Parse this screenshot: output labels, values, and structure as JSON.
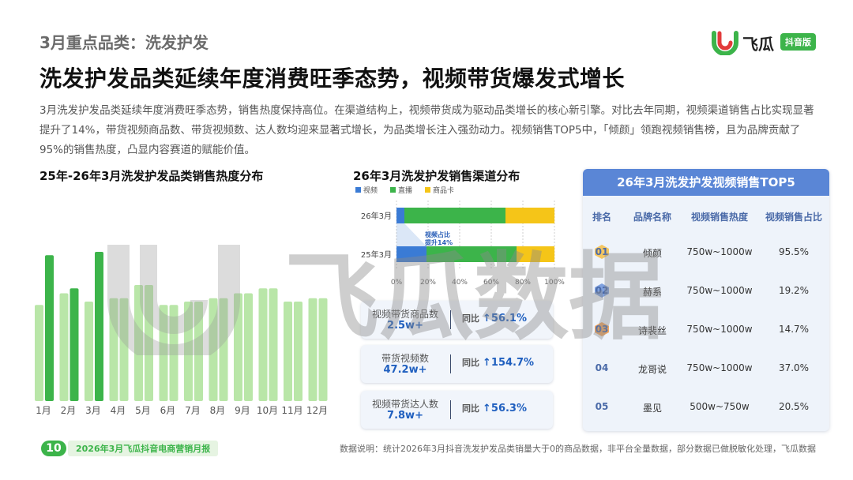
{
  "header": {
    "section_title": "3月重点品类：洗发护发",
    "main_title": "洗发护发品类延续年度消费旺季态势，视频带货爆发式增长",
    "description": "3月洗发护发品类延续年度消费旺季态势，销售热度保持高位。在渠道结构上，视频带货成为驱动品类增长的核心新引擎。对比去年同期，视频渠道销售占比实现显著提升了14%，带货视频商品数、带货视频数、达人数均迎来显著式增长，为品类增长注入强劲动力。视频销售TOP5中，「倾颜」领跑视频销售榜，且为品牌贡献了95%的销售热度，凸显内容赛道的赋能价值。"
  },
  "logo": {
    "text": "飞瓜",
    "badge": "抖音版"
  },
  "watermark": {
    "text": "飞瓜数据"
  },
  "chart_data": [
    {
      "type": "bar",
      "title": "25年-26年3月洗发护发品类销售热度分布",
      "categories": [
        "1月",
        "2月",
        "3月",
        "4月",
        "5月",
        "6月",
        "7月",
        "8月",
        "9月",
        "10月",
        "11月",
        "12月"
      ],
      "series": [
        {
          "values": [
            58,
            65,
            60,
            62,
            70,
            58,
            60,
            62,
            65,
            68,
            60,
            62
          ]
        },
        {
          "values": [
            88,
            68,
            90,
            null,
            null,
            null,
            null,
            null,
            null,
            null,
            null,
            null
          ]
        }
      ],
      "colors": [
        "#b9e6a8",
        "#3cb44a"
      ]
    },
    {
      "type": "bar",
      "stacked": true,
      "orientation": "horizontal",
      "title": "26年3月洗发护发销售渠道分布",
      "legend": [
        "视频",
        "直播",
        "商品卡"
      ],
      "legend_position": "top-left",
      "colors": [
        "#3a7bd5",
        "#3cb44a",
        "#f5c518"
      ],
      "categories": [
        "26年3月",
        "25年3月"
      ],
      "series": [
        {
          "name": "视频",
          "values": [
            5,
            19
          ]
        },
        {
          "name": "直播",
          "values": [
            64,
            57
          ]
        },
        {
          "name": "商品卡",
          "values": [
            31,
            24
          ]
        }
      ],
      "xticks": [
        "0%",
        "20%",
        "40%",
        "60%",
        "80%",
        "100%"
      ],
      "xlim": [
        0,
        100
      ],
      "annotation": [
        "视频占比",
        "提升14%"
      ]
    }
  ],
  "metrics": [
    {
      "label": "视频带货商品数",
      "value": "2.5w+",
      "change_label": "同比",
      "change": "↑56.1%"
    },
    {
      "label": "带货视频数",
      "value": "47.2w+",
      "change_label": "同比",
      "change": "↑154.7%"
    },
    {
      "label": "视频带货达人数",
      "value": "7.8w+",
      "change_label": "同比",
      "change": "↑56.3%"
    }
  ],
  "top5": {
    "title": "26年3月洗发护发视频销售TOP5",
    "columns": [
      "排名",
      "品牌名称",
      "视频销售热度",
      "视频销售占比"
    ],
    "rows": [
      {
        "rank": "01",
        "brand": "倾颜",
        "heat": "750w~1000w",
        "share": "95.5%"
      },
      {
        "rank": "02",
        "brand": "赫系",
        "heat": "750w~1000w",
        "share": "19.2%"
      },
      {
        "rank": "03",
        "brand": "诗裴丝",
        "heat": "750w~1000w",
        "share": "14.7%"
      },
      {
        "rank": "04",
        "brand": "龙哥说",
        "heat": "750w~1000w",
        "share": "37.0%"
      },
      {
        "rank": "05",
        "brand": "墨见",
        "heat": "500w~750w",
        "share": "20.5%"
      }
    ],
    "badge_colors": [
      "#f5b72e",
      "#5a86d6",
      "#f08a2a"
    ]
  },
  "footer": {
    "page": "10",
    "report": "2026年3月飞瓜抖音电商营销月报",
    "note": "数据说明：统计2026年3月抖音洗发护发品类销量大于0的商品数据，非平台全量数据，部分数据已做脱敏化处理，飞瓜数据"
  }
}
